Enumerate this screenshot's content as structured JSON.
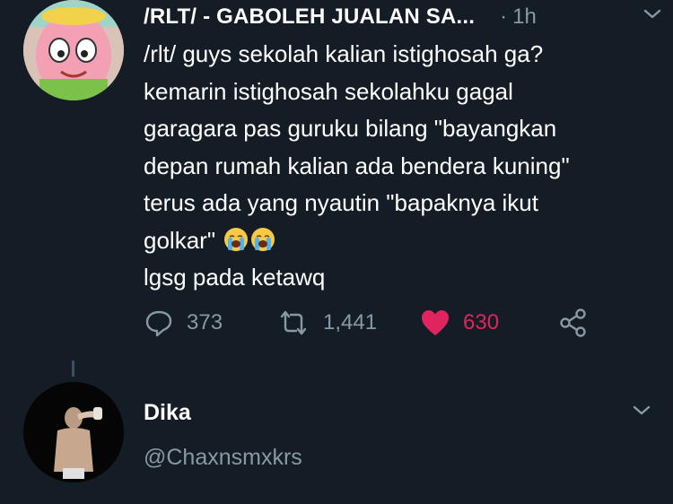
{
  "tweet": {
    "display_name": "/RLT/ - GABOLEH JUALAN SA...",
    "dot": "·",
    "time": "1h",
    "text_lines": [
      "/rlt/ guys sekolah kalian istighosah ga?",
      "kemarin istighosah sekolahku gagal",
      "garagara pas guruku bilang \"bayangkan",
      "depan rumah kalian ada bendera kuning\"",
      "terus ada yang nyautin \"bapaknya ikut",
      "golkar\"",
      "lgsg pada ketawq"
    ],
    "inline_emoji": "loudly-crying-face",
    "reply_count": "373",
    "retweet_count": "1,441",
    "like_count": "630",
    "colors": {
      "background": "#141d26",
      "muted": "#8899a6",
      "like": "#e0245e"
    }
  },
  "user": {
    "name": "Dika",
    "handle": "@Chaxnsmxkrs"
  }
}
